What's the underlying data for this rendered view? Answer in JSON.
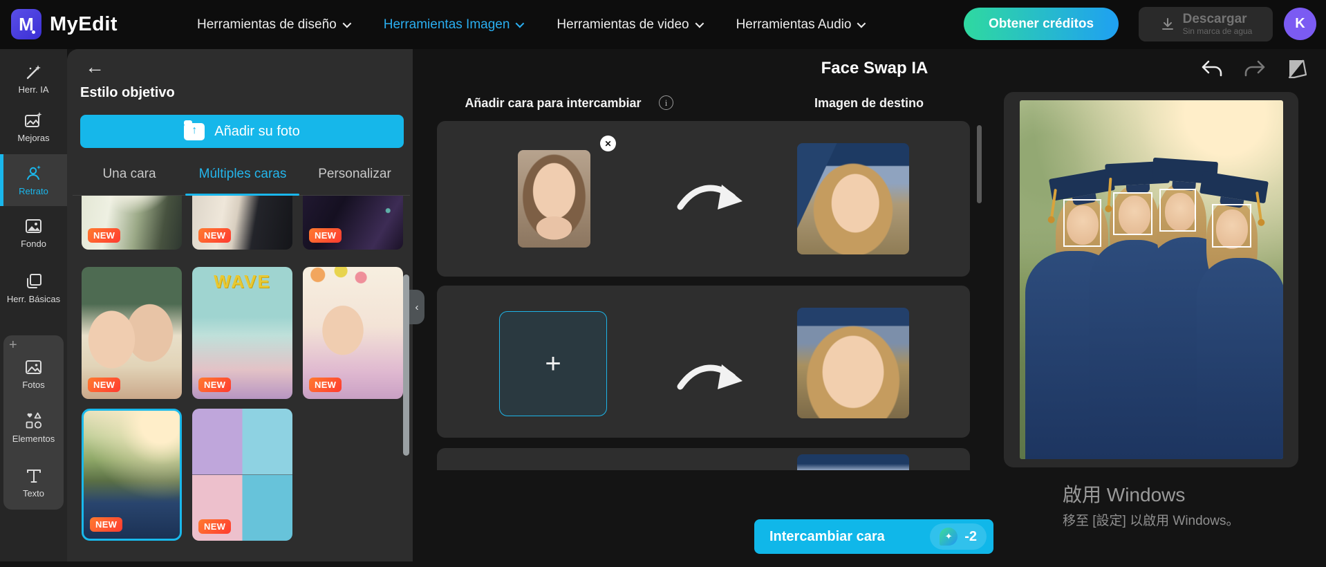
{
  "navbar": {
    "logo_glyph": "M",
    "logo_text": "MyEdit",
    "items": [
      {
        "label": "Herramientas de diseño"
      },
      {
        "label": "Herramientas Imagen",
        "accent": true
      },
      {
        "label": "Herramientas de video"
      },
      {
        "label": "Herramientas Audio"
      }
    ],
    "credits_button": "Obtener créditos",
    "download_button": {
      "label": "Descargar",
      "sublabel": "Sin marca de agua"
    },
    "avatar_initial": "K"
  },
  "rail": {
    "items": [
      {
        "label": "Herr. IA"
      },
      {
        "label": "Mejoras"
      },
      {
        "label": "Retrato",
        "selected": true
      },
      {
        "label": "Fondo"
      },
      {
        "label": "Herr. Básicas"
      }
    ],
    "library_items": [
      {
        "label": "Fotos"
      },
      {
        "label": "Elementos"
      },
      {
        "label": "Texto"
      }
    ]
  },
  "panel": {
    "heading": "Estilo objetivo",
    "add_photo_button": "Añadir su foto",
    "tabs": [
      {
        "label": "Una cara"
      },
      {
        "label": "Múltiples caras",
        "active": true
      },
      {
        "label": "Personalizar"
      }
    ],
    "thumbnails": [
      {
        "badge": "NEW",
        "style": "wedding-bouquet"
      },
      {
        "badge": "NEW",
        "style": "wedding-couple"
      },
      {
        "badge": "NEW",
        "style": "evening-sparkle"
      },
      {
        "badge": "NEW",
        "style": "classroom-couple"
      },
      {
        "badge": "NEW",
        "style": "magazine-wave",
        "overlay": "WAVE"
      },
      {
        "badge": "NEW",
        "style": "party-friends"
      },
      {
        "badge": "NEW",
        "style": "graduation",
        "selected": true
      },
      {
        "badge": "NEW",
        "style": "idol-grid"
      }
    ]
  },
  "main": {
    "title": "Face Swap IA",
    "source_label": "Añadir cara para intercambiar",
    "info_glyph": "i",
    "target_label": "Imagen de destino",
    "swap_button": "Intercambiar cara",
    "credit_cost": "-2"
  },
  "watermark": {
    "line1": "啟用 Windows",
    "line2": "移至 [設定] 以啟用 Windows。"
  }
}
